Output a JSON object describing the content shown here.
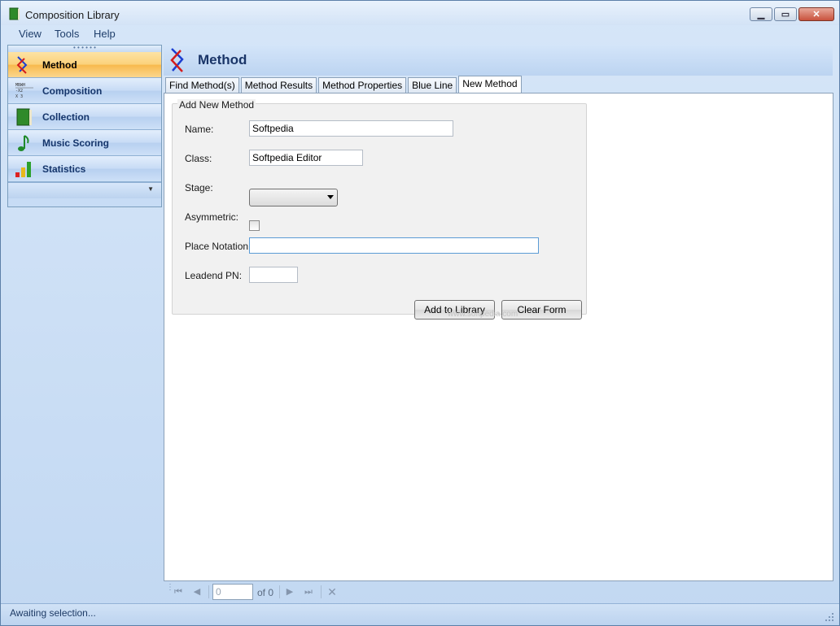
{
  "window": {
    "title": "Composition Library"
  },
  "menu": [
    {
      "label": "View"
    },
    {
      "label": "Tools"
    },
    {
      "label": "Help"
    }
  ],
  "sidebar": {
    "items": [
      {
        "label": "Method",
        "icon": "method-icon",
        "active": true
      },
      {
        "label": "Composition",
        "icon": "composition-icon",
        "active": false
      },
      {
        "label": "Collection",
        "icon": "book-icon",
        "active": false
      },
      {
        "label": "Music Scoring",
        "icon": "music-note-icon",
        "active": false
      },
      {
        "label": "Statistics",
        "icon": "bar-chart-icon",
        "active": false
      }
    ]
  },
  "main": {
    "title": "Method",
    "tabs": [
      {
        "label": "Find Method(s)",
        "active": false
      },
      {
        "label": "Method Results",
        "active": false
      },
      {
        "label": "Method Properties",
        "active": false
      },
      {
        "label": "Blue Line",
        "active": false
      },
      {
        "label": "New Method",
        "active": true
      }
    ],
    "form": {
      "legend": "Add New Method",
      "name_label": "Name:",
      "name_value": "Softpedia",
      "class_label": "Class:",
      "class_value": "Softpedia Editor",
      "stage_label": "Stage:",
      "stage_value": "",
      "asymmetric_label": "Asymmetric:",
      "asymmetric_checked": false,
      "place_notation_label": "Place Notation:",
      "place_notation_value": "",
      "leadend_label": "Leadend PN:",
      "leadend_value": "",
      "add_button": "Add to Library",
      "clear_button": "Clear Form"
    },
    "watermark": "www.softpedia.com"
  },
  "navigator": {
    "position": "0",
    "of_label": "of 0"
  },
  "status": {
    "text": "Awaiting selection..."
  },
  "colors": {
    "accent": "#1a3568",
    "active_nav": "#f8b94c",
    "panel": "#c7dcf5"
  }
}
